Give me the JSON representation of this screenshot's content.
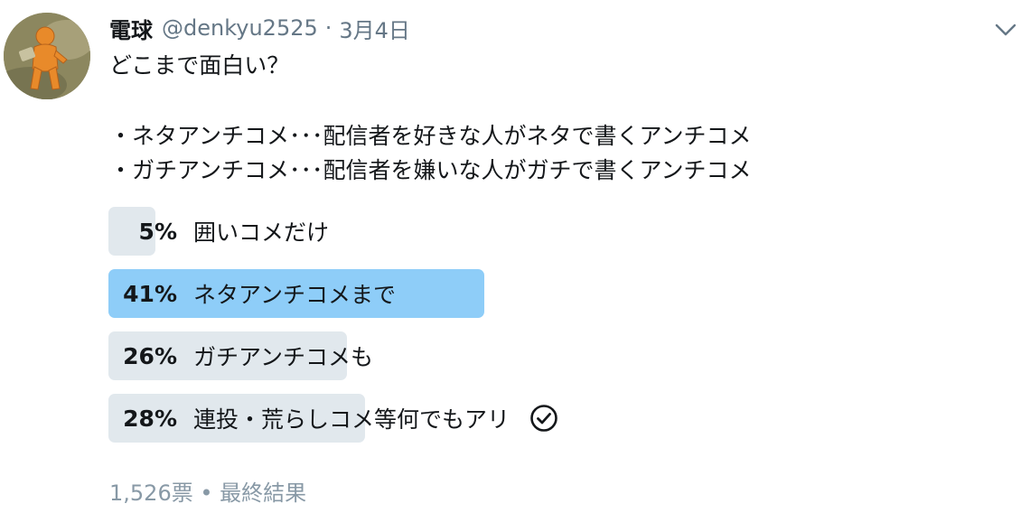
{
  "author": {
    "name": "電球",
    "handle": "@denkyu2525",
    "separator": "·",
    "date": "3月4日",
    "avatar_icon": "avatar-photo"
  },
  "menu": {
    "icon": "chevron-down-icon"
  },
  "tweet": {
    "lines": [
      "どこまで面白い？",
      "",
      "・ネタアンチコメ･･･配信者を好きな人がネタで書くアンチコメ",
      "・ガチアンチコメ･･･配信者を嫌いな人がガチで書くアンチコメ"
    ]
  },
  "poll": {
    "options": [
      {
        "percent_label": "5%",
        "percent": 5,
        "label": "囲いコメだけ",
        "winner": false,
        "selected": false
      },
      {
        "percent_label": "41%",
        "percent": 41,
        "label": "ネタアンチコメまで",
        "winner": true,
        "selected": false
      },
      {
        "percent_label": "26%",
        "percent": 26,
        "label": "ガチアンチコメも",
        "winner": false,
        "selected": false
      },
      {
        "percent_label": "28%",
        "percent": 28,
        "label": "連投・荒らしコメ等何でもアリ",
        "winner": false,
        "selected": true
      }
    ],
    "footer": "1,526票 • 最終結果",
    "colors": {
      "bar": "#e1e8ed",
      "winner_bar": "#8ecdf8",
      "footer": "#8899a6"
    }
  }
}
